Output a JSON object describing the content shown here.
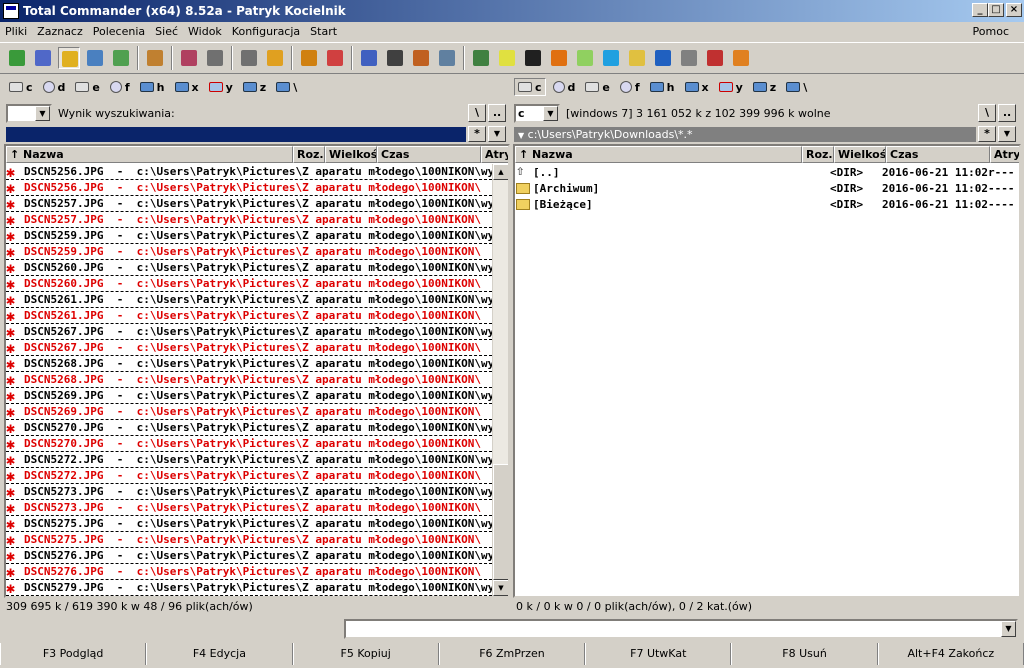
{
  "window": {
    "title": "Total Commander (x64) 8.52a - Patryk Kocielnik"
  },
  "menu": {
    "items": [
      "Pliki",
      "Zaznacz",
      "Polecenia",
      "Sieć",
      "Widok",
      "Konfiguracja",
      "Start"
    ],
    "help": "Pomoc"
  },
  "toolbar": {
    "icons": [
      "refresh-icon",
      "brief-view-icon",
      "full-view-icon",
      "thumbnail-view-icon",
      "tree-view-icon",
      "compare-dirs-icon",
      "pack-icon",
      "back-icon",
      "forward-icon",
      "archive-pack-icon",
      "archive-unpack-icon",
      "ftp-icon",
      "url-icon",
      "find-icon",
      "multi-rename-icon",
      "sync-dirs-icon",
      "netdrive-icon",
      "notepad-icon",
      "cmd-icon",
      "vlc-icon",
      "alien-icon",
      "calc-icon",
      "folder-icon",
      "book-icon",
      "settings-icon",
      "paint-icon",
      "u-icon"
    ]
  },
  "drives": {
    "left": [
      "c",
      "d",
      "e",
      "f",
      "h",
      "x",
      "y",
      "z",
      "\\"
    ],
    "right": [
      "c",
      "d",
      "e",
      "f",
      "h",
      "x",
      "y",
      "z",
      "\\"
    ]
  },
  "left": {
    "drive_combo": "",
    "info": "Wynik wyszukiwania:",
    "path": "",
    "btn_root": "\\",
    "btn_up": "..",
    "btn_star": "*",
    "headers": {
      "name": "Nazwa",
      "ext": "Roz.",
      "size": "Wielkość",
      "date": "Czas",
      "attr": "Atryb"
    },
    "rows": [
      {
        "name": "DSCN5256.JPG",
        "path": "c:\\Users\\Patryk\\Pictures\\Z aparatu młodego\\100NIKON\\wy...",
        "red": false
      },
      {
        "name": "DSCN5256.JPG",
        "path": "c:\\Users\\Patryk\\Pictures\\Z aparatu młodego\\100NIKON\\",
        "red": true
      },
      {
        "name": "DSCN5257.JPG",
        "path": "c:\\Users\\Patryk\\Pictures\\Z aparatu młodego\\100NIKON\\wy...",
        "red": false
      },
      {
        "name": "DSCN5257.JPG",
        "path": "c:\\Users\\Patryk\\Pictures\\Z aparatu młodego\\100NIKON\\",
        "red": true
      },
      {
        "name": "DSCN5259.JPG",
        "path": "c:\\Users\\Patryk\\Pictures\\Z aparatu młodego\\100NIKON\\wy...",
        "red": false
      },
      {
        "name": "DSCN5259.JPG",
        "path": "c:\\Users\\Patryk\\Pictures\\Z aparatu młodego\\100NIKON\\",
        "red": true
      },
      {
        "name": "DSCN5260.JPG",
        "path": "c:\\Users\\Patryk\\Pictures\\Z aparatu młodego\\100NIKON\\wy...",
        "red": false
      },
      {
        "name": "DSCN5260.JPG",
        "path": "c:\\Users\\Patryk\\Pictures\\Z aparatu młodego\\100NIKON\\",
        "red": true
      },
      {
        "name": "DSCN5261.JPG",
        "path": "c:\\Users\\Patryk\\Pictures\\Z aparatu młodego\\100NIKON\\wy...",
        "red": false
      },
      {
        "name": "DSCN5261.JPG",
        "path": "c:\\Users\\Patryk\\Pictures\\Z aparatu młodego\\100NIKON\\",
        "red": true
      },
      {
        "name": "DSCN5267.JPG",
        "path": "c:\\Users\\Patryk\\Pictures\\Z aparatu młodego\\100NIKON\\wy...",
        "red": false
      },
      {
        "name": "DSCN5267.JPG",
        "path": "c:\\Users\\Patryk\\Pictures\\Z aparatu młodego\\100NIKON\\",
        "red": true
      },
      {
        "name": "DSCN5268.JPG",
        "path": "c:\\Users\\Patryk\\Pictures\\Z aparatu młodego\\100NIKON\\wy...",
        "red": false
      },
      {
        "name": "DSCN5268.JPG",
        "path": "c:\\Users\\Patryk\\Pictures\\Z aparatu młodego\\100NIKON\\",
        "red": true
      },
      {
        "name": "DSCN5269.JPG",
        "path": "c:\\Users\\Patryk\\Pictures\\Z aparatu młodego\\100NIKON\\wy...",
        "red": false
      },
      {
        "name": "DSCN5269.JPG",
        "path": "c:\\Users\\Patryk\\Pictures\\Z aparatu młodego\\100NIKON\\",
        "red": true
      },
      {
        "name": "DSCN5270.JPG",
        "path": "c:\\Users\\Patryk\\Pictures\\Z aparatu młodego\\100NIKON\\wy...",
        "red": false
      },
      {
        "name": "DSCN5270.JPG",
        "path": "c:\\Users\\Patryk\\Pictures\\Z aparatu młodego\\100NIKON\\",
        "red": true
      },
      {
        "name": "DSCN5272.JPG",
        "path": "c:\\Users\\Patryk\\Pictures\\Z aparatu młodego\\100NIKON\\wy...",
        "red": false
      },
      {
        "name": "DSCN5272.JPG",
        "path": "c:\\Users\\Patryk\\Pictures\\Z aparatu młodego\\100NIKON\\",
        "red": true
      },
      {
        "name": "DSCN5273.JPG",
        "path": "c:\\Users\\Patryk\\Pictures\\Z aparatu młodego\\100NIKON\\wy...",
        "red": false
      },
      {
        "name": "DSCN5273.JPG",
        "path": "c:\\Users\\Patryk\\Pictures\\Z aparatu młodego\\100NIKON\\",
        "red": true
      },
      {
        "name": "DSCN5275.JPG",
        "path": "c:\\Users\\Patryk\\Pictures\\Z aparatu młodego\\100NIKON\\wy...",
        "red": false
      },
      {
        "name": "DSCN5275.JPG",
        "path": "c:\\Users\\Patryk\\Pictures\\Z aparatu młodego\\100NIKON\\",
        "red": true
      },
      {
        "name": "DSCN5276.JPG",
        "path": "c:\\Users\\Patryk\\Pictures\\Z aparatu młodego\\100NIKON\\wy...",
        "red": false
      },
      {
        "name": "DSCN5276.JPG",
        "path": "c:\\Users\\Patryk\\Pictures\\Z aparatu młodego\\100NIKON\\",
        "red": true
      },
      {
        "name": "DSCN5279.JPG",
        "path": "c:\\Users\\Patryk\\Pictures\\Z aparatu młodego\\100NIKON\\wy...",
        "red": false
      }
    ],
    "status": "309 695 k / 619 390 k w 48 / 96 plik(ach/ów)"
  },
  "right": {
    "drive_combo": "c",
    "info": "[windows 7]  3 161 052 k z 102 399 996 k wolne",
    "path": "c:\\Users\\Patryk\\Downloads\\*.*",
    "btn_root": "\\",
    "btn_up": "..",
    "btn_star": "*",
    "headers": {
      "name": "Nazwa",
      "ext": "Roz.",
      "size": "Wielkość",
      "date": "Czas",
      "attr": "Atryb"
    },
    "rows": [
      {
        "name": "[..]",
        "size": "<DIR>",
        "date": "2016-06-21 11:02",
        "attr": "r---",
        "type": "up"
      },
      {
        "name": "[Archiwum]",
        "size": "<DIR>",
        "date": "2016-06-21 11:02",
        "attr": "----",
        "type": "folder"
      },
      {
        "name": "[Bieżące]",
        "size": "<DIR>",
        "date": "2016-06-21 11:02",
        "attr": "----",
        "type": "folder"
      }
    ],
    "status": "0 k / 0 k w 0 / 0 plik(ach/ów), 0 / 2 kat.(ów)"
  },
  "commandline": {
    "value": ""
  },
  "fkeys": [
    "F3 Podgląd",
    "F4 Edycja",
    "F5 Kopiuj",
    "F6 ZmPrzen",
    "F7 UtwKat",
    "F8 Usuń",
    "Alt+F4 Zakończ"
  ]
}
